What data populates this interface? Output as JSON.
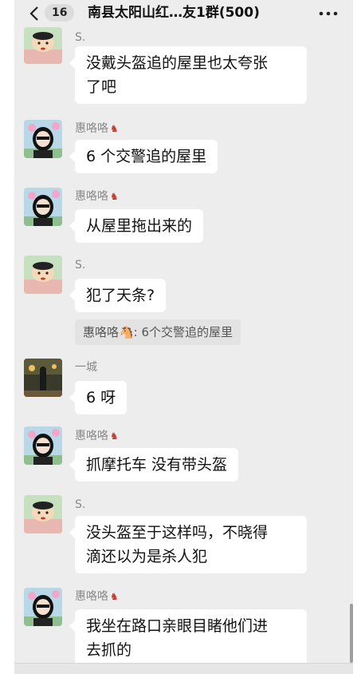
{
  "topbar": {
    "badge": "16",
    "title": "南县太阳山红…友1群(500)"
  },
  "messages": [
    {
      "sender": "S.",
      "text_lines": [
        "没戴头盔追的屋里也太夸张",
        "了吧"
      ],
      "avatar": "crayon-shinchan-avatar"
    },
    {
      "sender": "惠咯咯",
      "text_lines": [
        "6 个交警追的屋里"
      ],
      "avatar": "anime-girl-avatar"
    },
    {
      "sender": "惠咯咯",
      "text_lines": [
        "从屋里拖出来的"
      ],
      "avatar": "anime-girl-avatar"
    },
    {
      "sender": "S.",
      "text_lines": [
        "犯了天条?"
      ],
      "avatar": "crayon-shinchan-avatar",
      "quote": "惠咯咯🐴: 6个交警追的屋里"
    },
    {
      "sender": "一城",
      "text_lines": [
        "6 呀"
      ],
      "avatar": "night-street-avatar"
    },
    {
      "sender": "惠咯咯",
      "text_lines": [
        "抓摩托车 没有带头盔"
      ],
      "avatar": "anime-girl-avatar"
    },
    {
      "sender": "S.",
      "text_lines": [
        "没头盔至于这样吗，不晓得",
        "滴还以为是杀人犯"
      ],
      "avatar": "crayon-shinchan-avatar"
    },
    {
      "sender": "惠咯咯",
      "text_lines": [
        "我坐在路口亲眼目睹他们进",
        "去抓的"
      ],
      "avatar": "anime-girl-avatar"
    }
  ],
  "colors": {
    "background": "#ededed",
    "bubble": "#ffffff",
    "sender_text": "#888888"
  }
}
